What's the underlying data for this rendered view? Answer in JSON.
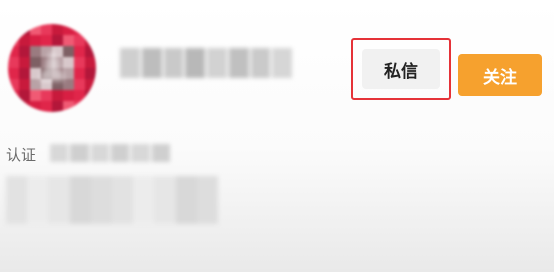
{
  "profile": {
    "avatar_icon": "user-avatar-icon",
    "message_button_label": "私信",
    "follow_button_label": "关注",
    "certification_label": "认证",
    "colors": {
      "follow_button": "#f6a12e",
      "highlight_border": "#e53238",
      "message_button_bg": "#f1f1f1"
    }
  }
}
